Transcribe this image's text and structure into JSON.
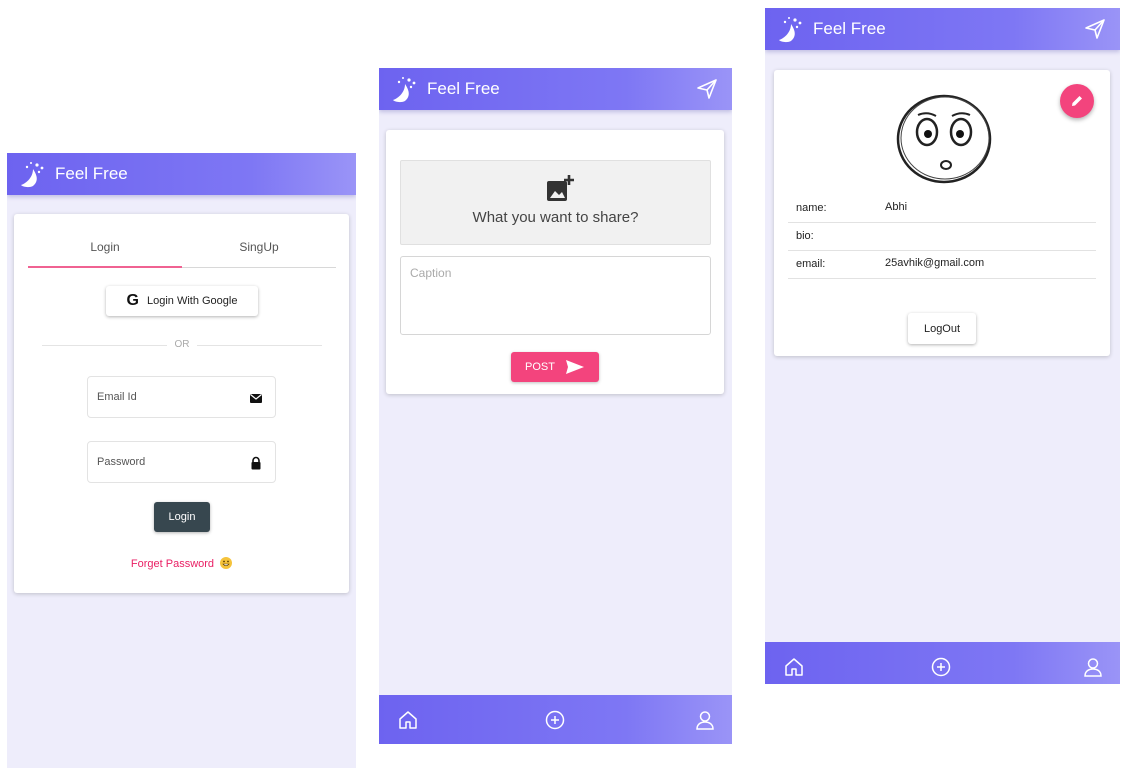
{
  "app": {
    "name": "Feel Free"
  },
  "colors": {
    "primary": "#6d63f0",
    "accent": "#f3447d",
    "dark_button": "#37474f",
    "background": "#eeedfb"
  },
  "login_screen": {
    "tabs": [
      {
        "label": "Login",
        "active": true
      },
      {
        "label": "SingUp",
        "active": false
      }
    ],
    "google_button": "Login With Google",
    "divider_text": "OR",
    "email_placeholder": "Email Id",
    "password_placeholder": "Password",
    "login_button": "Login",
    "forget_password": "Forget Password",
    "icons": [
      "logo-icon",
      "google-icon",
      "mail-icon",
      "lock-icon",
      "emoji-icon"
    ]
  },
  "post_screen": {
    "share_prompt": "What you want to share?",
    "caption_placeholder": "Caption",
    "post_button": "POST",
    "icons": [
      "logo-icon",
      "send-icon",
      "add-image-icon",
      "send-arrow-icon",
      "home-icon",
      "add-circle-icon",
      "user-icon"
    ]
  },
  "profile_screen": {
    "fields": [
      {
        "key": "name:",
        "value": "Abhi"
      },
      {
        "key": "bio:",
        "value": ""
      },
      {
        "key": "email:",
        "value": "25avhik@gmail.com"
      }
    ],
    "logout_button": "LogOut",
    "icons": [
      "logo-icon",
      "send-icon",
      "avatar-sketch",
      "edit-pencil-icon",
      "home-icon",
      "add-circle-icon",
      "user-icon"
    ]
  }
}
